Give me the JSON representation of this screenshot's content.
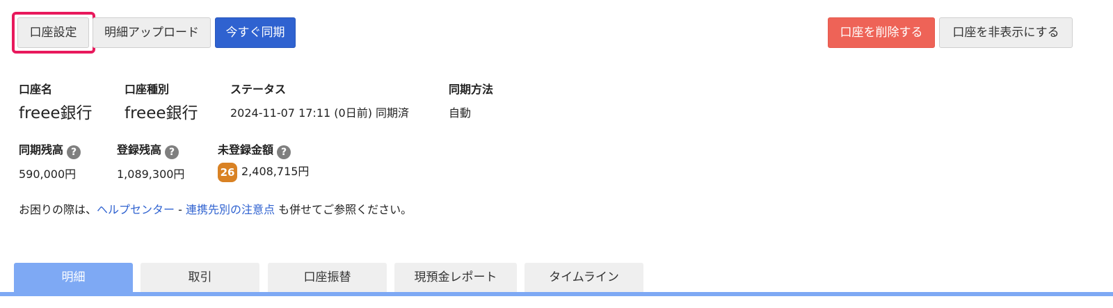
{
  "toolbar": {
    "account_settings_label": "口座設定",
    "statement_upload_label": "明細アップロード",
    "sync_now_label": "今すぐ同期",
    "delete_account_label": "口座を削除する",
    "hide_account_label": "口座を非表示にする"
  },
  "info": {
    "account_name": {
      "label": "口座名",
      "value": "freee銀行"
    },
    "account_type": {
      "label": "口座種別",
      "value": "freee銀行"
    },
    "status": {
      "label": "ステータス",
      "value": "2024-11-07 17:11 (0日前) 同期済"
    },
    "sync_method": {
      "label": "同期方法",
      "value": "自動"
    }
  },
  "balances": {
    "synced_balance": {
      "label": "同期残高",
      "value": "590,000円"
    },
    "registered_balance": {
      "label": "登録残高",
      "value": "1,089,300円"
    },
    "unregistered_amount": {
      "label": "未登録金額",
      "count": "26",
      "value": "2,408,715円"
    },
    "help_glyph": "?"
  },
  "help": {
    "prefix": "お困りの際は、",
    "help_center_link": "ヘルプセンター",
    "separator": " - ",
    "partner_notes_link": "連携先別の注意点",
    "suffix": " も併せてご参照ください。"
  },
  "tabs": [
    {
      "label": "明細",
      "active": true
    },
    {
      "label": "取引",
      "active": false
    },
    {
      "label": "口座振替",
      "active": false
    },
    {
      "label": "現預金レポート",
      "active": false
    },
    {
      "label": "タイムライン",
      "active": false
    }
  ],
  "colors": {
    "primary": "#2f62d0",
    "danger": "#ee6357",
    "highlight": "#e8195c",
    "badge": "#d98224",
    "active_tab": "#7ea9f4"
  },
  "icons": {
    "help": "question-circle-icon"
  }
}
